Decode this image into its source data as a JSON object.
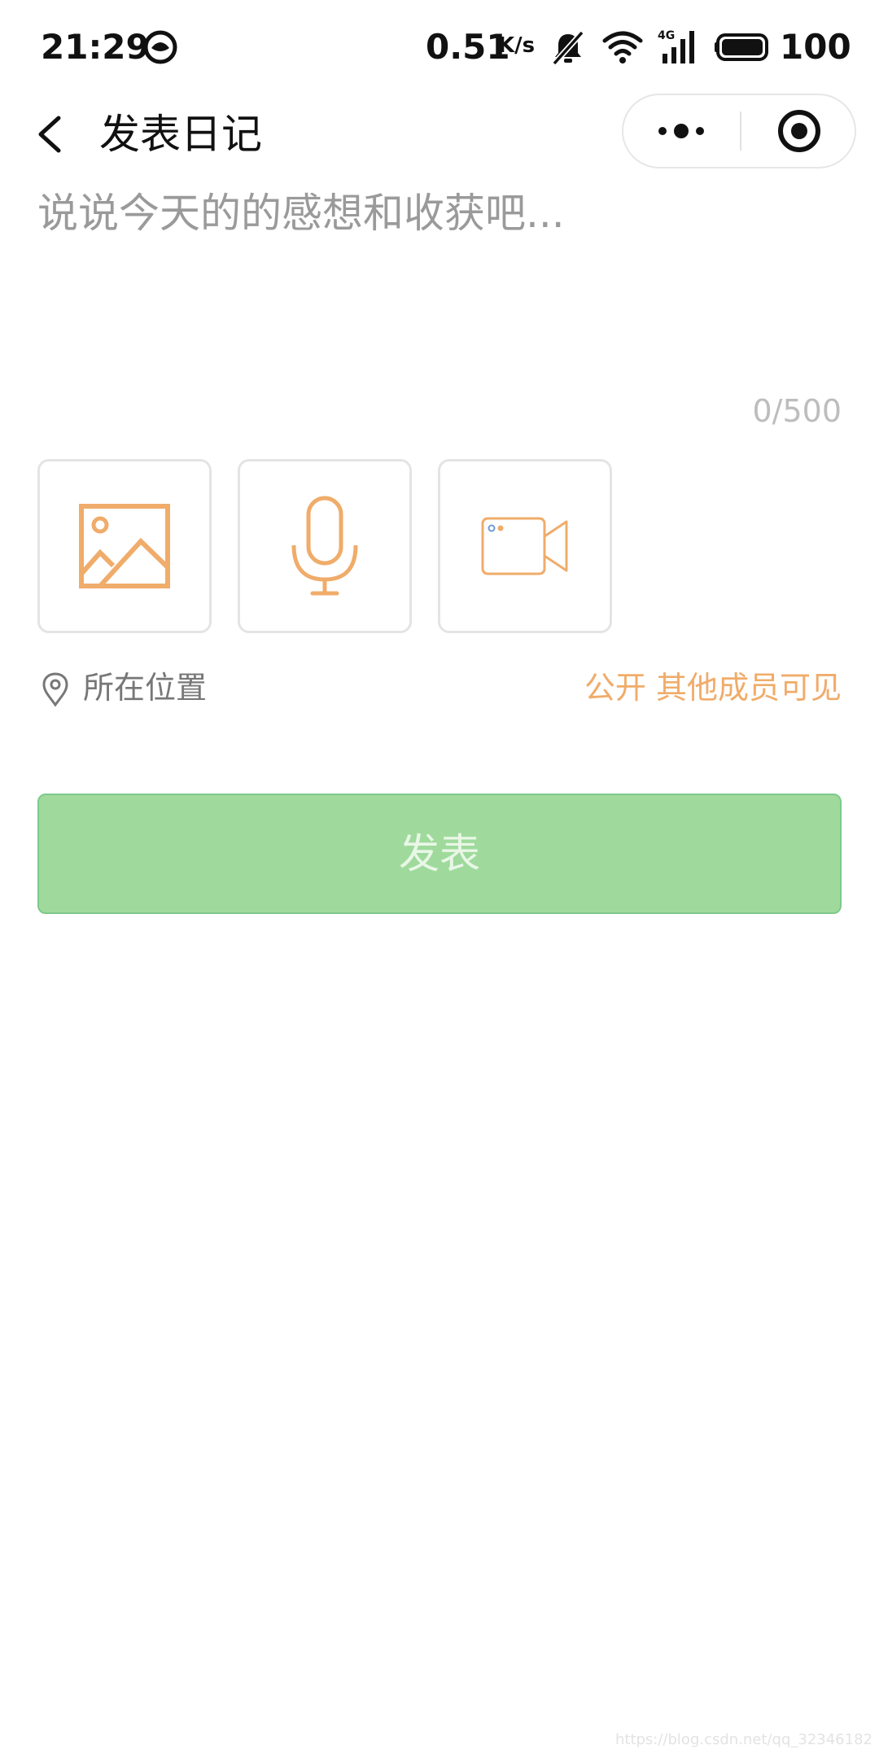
{
  "status_bar": {
    "time": "21:29",
    "net_speed": "0.51",
    "net_speed_unit": "K/s",
    "signal_label": "4G",
    "battery": "100"
  },
  "nav": {
    "title": "发表日记"
  },
  "editor": {
    "placeholder": "说说今天的的感想和收获吧...",
    "value": "",
    "counter": "0/500"
  },
  "media": {
    "icons": [
      "image-icon",
      "microphone-icon",
      "video-camera-icon"
    ]
  },
  "location": {
    "label": "所在位置"
  },
  "visibility": {
    "label": "公开 其他成员可见"
  },
  "publish": {
    "label": "发表"
  },
  "colors": {
    "accent_orange": "#f0ac6a",
    "button_green": "#9fda9c",
    "button_border": "#7fc98b",
    "button_text": "#e9f7e7",
    "placeholder": "#9a9a9a",
    "counter": "#bdbdbd"
  },
  "watermark": "https://blog.csdn.net/qq_32346182"
}
